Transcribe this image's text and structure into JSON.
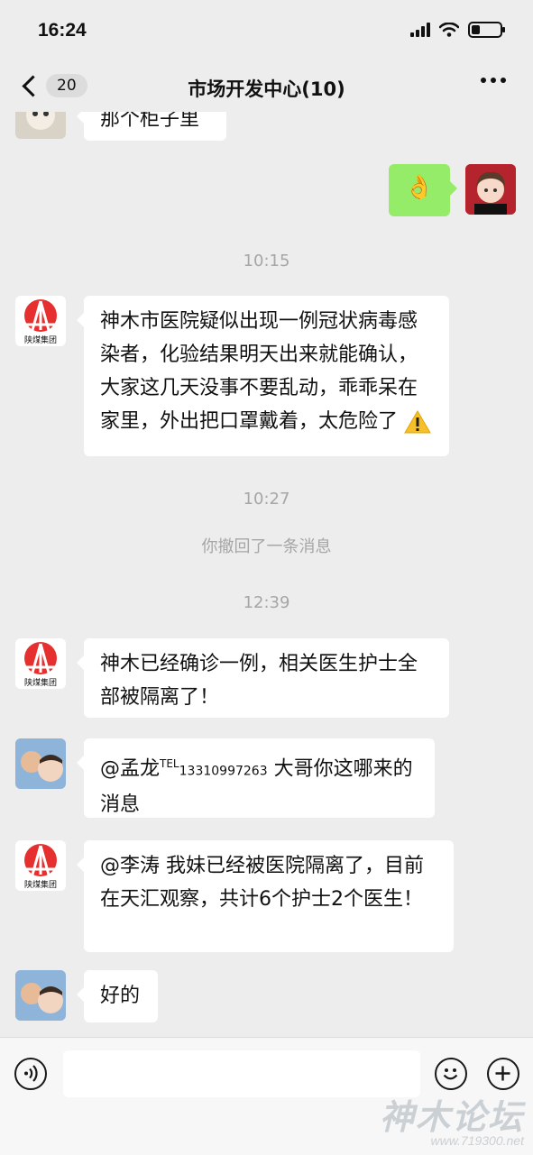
{
  "status_bar": {
    "time": "16:24"
  },
  "header": {
    "back_badge": "20",
    "title": "市场开发中心(10)"
  },
  "messages": {
    "top_partial": "那个柜子里",
    "sent_emoji": "👌",
    "ts1": "10:15",
    "msg1": "神木市医院疑似出现一例冠状病毒感染者，化验结果明天出来就能确认，大家这几天没事不要乱动，乖乖呆在家里，外出把口罩戴着，太危险了",
    "ts2": "10:27",
    "recall": "你撤回了一条消息",
    "ts3": "12:39",
    "msg2": "神木已经确诊一例，相关医生护士全部被隔离了！",
    "msg3_mention": "@孟龙",
    "msg3_tel": "TEL",
    "msg3_phone": "13310997263",
    "msg3_text": " 大哥你这哪来的消息",
    "msg4": "@李涛 我妹已经被医院隔离了，目前在天汇观察，共计6个护士2个医生！",
    "msg5": "好的"
  },
  "logo_text": "陕煤集团",
  "watermark": {
    "title": "神木论坛",
    "url": "www.719300.net"
  },
  "icons": [
    "back-chevron-icon",
    "more-icon",
    "warning-icon",
    "voice-icon",
    "emoji-icon",
    "plus-icon"
  ]
}
